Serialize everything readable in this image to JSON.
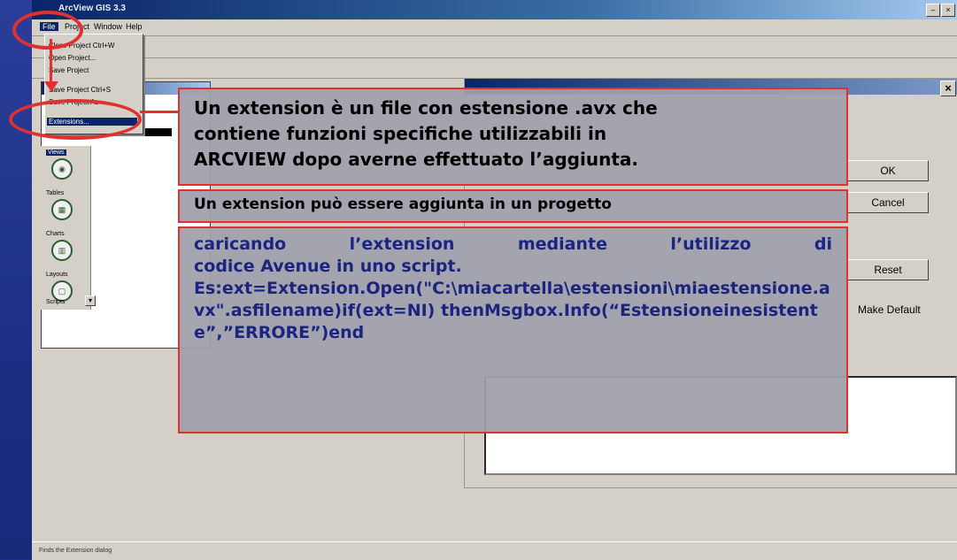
{
  "window": {
    "title": "ArcView GIS 3.3"
  },
  "menubar": {
    "items": [
      "File",
      "Project",
      "Window",
      "Help"
    ]
  },
  "file_menu": {
    "items": [
      "Close Project   Ctrl+W",
      "Open Project...",
      "Save Project",
      "Save Project   Ctrl+S",
      "Save Project As",
      "Extensions..."
    ]
  },
  "project": {
    "icons": [
      "Views",
      "Tables",
      "Charts",
      "Layouts",
      "Scripts"
    ],
    "selected": "Views"
  },
  "dialog": {
    "ok_label": "OK",
    "cancel_label": "Cancel",
    "reset_label": "Reset",
    "make_default_label": "Make Default"
  },
  "callouts": {
    "definition": [
      "Un extension è un file con estensione .avx che",
      "contiene funzioni specifiche utilizzabili in",
      "ARCVIEW dopo averne effettuato l’aggiunta."
    ],
    "subtitle": "Un extension può essere aggiunta in un progetto",
    "method": [
      "caricando l’extension mediante l’utilizzo di",
      "codice Avenue in uno script."
    ],
    "code": "Es:ext=Extension.Open(\"C:\\miacartella\\estensioni\\miaestensione.avx\".asfilename)if(ext=NI) thenMsgbox.Info(“Estensioneinesistente”,”ERRORE”)end"
  },
  "statusbar": {
    "text": "Finds the Extension dialog"
  },
  "colors": {
    "callout_border": "#e03030",
    "callout_fill": "#a0a0ac",
    "code_text": "#1c2480",
    "slide_bg": "#1d2f86"
  }
}
